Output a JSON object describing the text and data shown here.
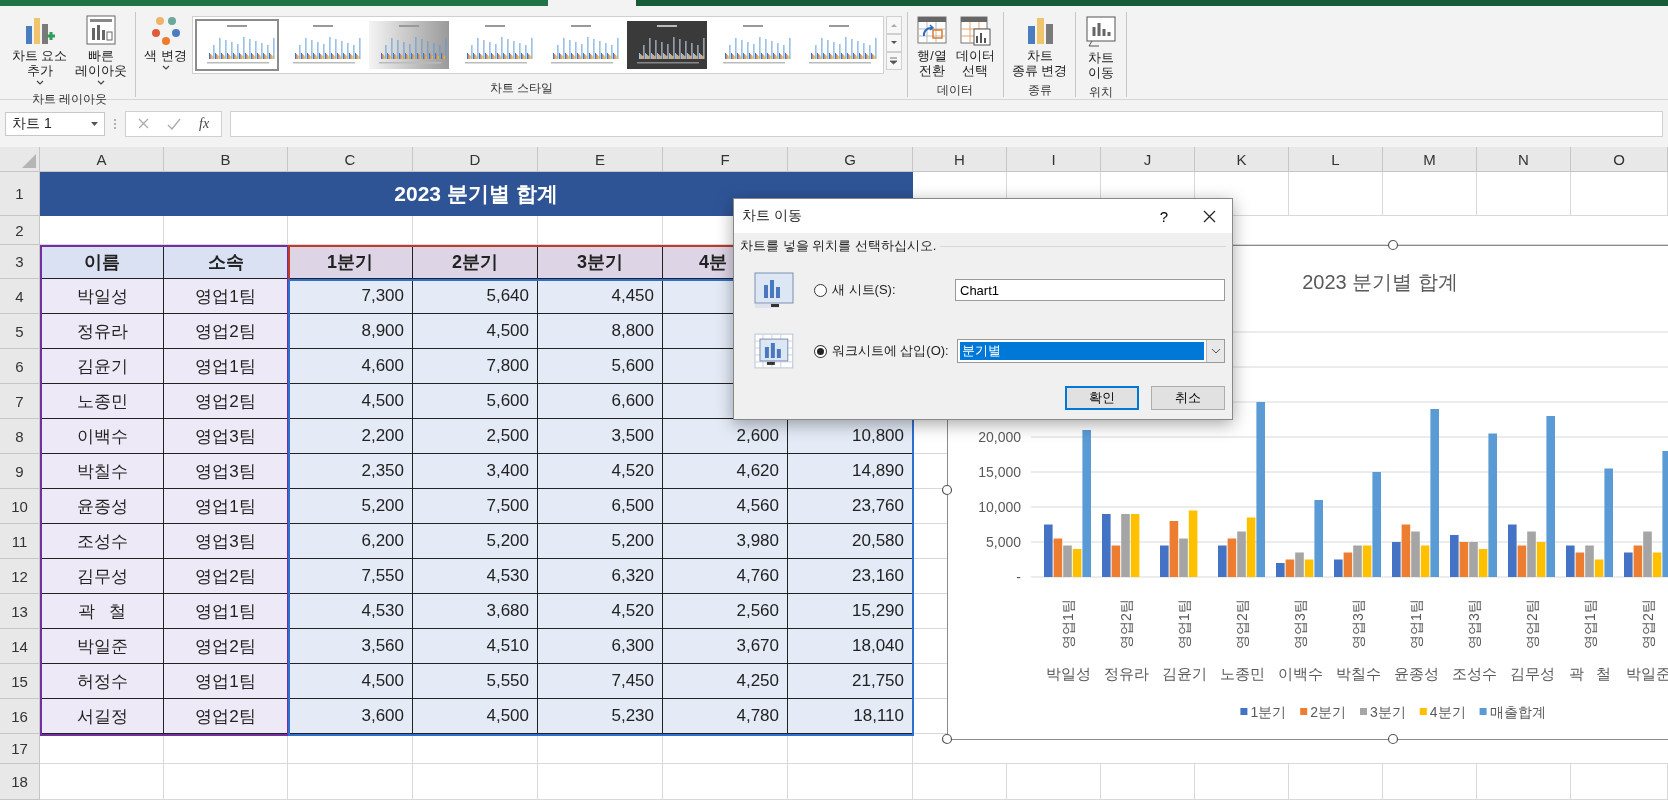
{
  "ribbon": {
    "groups": [
      {
        "label": "차트 레이아웃",
        "buttons": [
          {
            "kind": "chart-elements",
            "lines": [
              "차트 요소",
              "추가"
            ],
            "dropdown": true
          },
          {
            "kind": "quick-layout",
            "lines": [
              "빠른",
              "레이아웃"
            ],
            "dropdown": true
          }
        ]
      },
      {
        "label": "차트 스타일",
        "buttons": [
          {
            "kind": "colors",
            "lines": [
              "색 변경"
            ],
            "dropdown": true
          }
        ],
        "gallery": [
          {
            "kind": "white",
            "selected": true
          },
          {
            "kind": "white",
            "selected": false
          },
          {
            "kind": "gray",
            "selected": false
          },
          {
            "kind": "white",
            "selected": false
          },
          {
            "kind": "white",
            "selected": false
          },
          {
            "kind": "dark",
            "selected": false
          },
          {
            "kind": "white",
            "selected": false
          },
          {
            "kind": "white",
            "selected": false
          }
        ]
      },
      {
        "label": "데이터",
        "buttons": [
          {
            "kind": "switch",
            "lines": [
              "행/열",
              "전환"
            ]
          },
          {
            "kind": "select-data",
            "lines": [
              "데이터",
              "선택"
            ]
          }
        ]
      },
      {
        "label": "종류",
        "buttons": [
          {
            "kind": "chart-type",
            "lines": [
              "차트",
              "종류 변경"
            ]
          }
        ]
      },
      {
        "label": "위치",
        "buttons": [
          {
            "kind": "move-chart",
            "lines": [
              "차트",
              "이동"
            ]
          }
        ]
      }
    ]
  },
  "formula_bar": {
    "name_box": "차트 1",
    "function_label": "fx"
  },
  "sheet": {
    "columns": [
      "A",
      "B",
      "C",
      "D",
      "E",
      "F",
      "G",
      "H",
      "I",
      "J",
      "K",
      "L",
      "M",
      "N",
      "O"
    ],
    "row_numbers": [
      "1",
      "2",
      "3",
      "4",
      "5",
      "6",
      "7",
      "8",
      "9",
      "10",
      "11",
      "12",
      "13",
      "14",
      "15",
      "16",
      "17",
      "18"
    ],
    "title": "2023 분기별 합계",
    "header": [
      {
        "text": "이름"
      },
      {
        "text": "소속"
      },
      {
        "text": "1분기"
      },
      {
        "text": "2분기"
      },
      {
        "text": "3분기"
      },
      {
        "text": "4분",
        "cut": true
      }
    ],
    "rows": [
      [
        "박일성",
        "영업1팀",
        "7,300",
        "5,640",
        "4,450"
      ],
      [
        "정유라",
        "영업2팀",
        "8,900",
        "4,500",
        "8,800"
      ],
      [
        "김윤기",
        "영업1팀",
        "4,600",
        "7,800",
        "5,600"
      ],
      [
        "노종민",
        "영업2팀",
        "4,500",
        "5,600",
        "6,600"
      ],
      [
        "이백수",
        "영업3팀",
        "2,200",
        "2,500",
        "3,500",
        "2,600",
        "10,800"
      ],
      [
        "박칠수",
        "영업3팀",
        "2,350",
        "3,400",
        "4,520",
        "4,620",
        "14,890"
      ],
      [
        "윤종성",
        "영업1팀",
        "5,200",
        "7,500",
        "6,500",
        "4,560",
        "23,760"
      ],
      [
        "조성수",
        "영업3팀",
        "6,200",
        "5,200",
        "5,200",
        "3,980",
        "20,580"
      ],
      [
        "김무성",
        "영업2팀",
        "7,550",
        "4,530",
        "6,320",
        "4,760",
        "23,160"
      ],
      [
        "곽   철",
        "영업1팀",
        "4,530",
        "3,680",
        "4,520",
        "2,560",
        "15,290"
      ],
      [
        "박일준",
        "영업2팀",
        "3,560",
        "4,510",
        "6,300",
        "3,670",
        "18,040"
      ],
      [
        "허정수",
        "영업1팀",
        "4,500",
        "5,550",
        "7,450",
        "4,250",
        "21,750"
      ],
      [
        "서길정",
        "영업2팀",
        "3,600",
        "4,500",
        "5,230",
        "4,780",
        "18,110"
      ]
    ]
  },
  "chart": {
    "team_labels": [
      "영업1팀",
      "영업2팀",
      "영업1팀",
      "영업2팀",
      "영업3팀",
      "영업3팀",
      "영업1팀",
      "영업3팀",
      "영업2팀",
      "영업1팀",
      "영업2팀"
    ],
    "chart_data": {
      "type": "bar",
      "title": "2023 분기별 합계",
      "categories": [
        "박일성",
        "정유라",
        "김윤기",
        "노종민",
        "이백수",
        "박칠수",
        "윤종성",
        "조성수",
        "김무성",
        "곽   철",
        "박일준"
      ],
      "series": [
        {
          "name": "1분기",
          "color": "#4472c4",
          "values": [
            7500,
            9000,
            4500,
            4500,
            2000,
            2500,
            5000,
            6000,
            7500,
            4500,
            3500
          ]
        },
        {
          "name": "2분기",
          "color": "#ed7d31",
          "values": [
            5500,
            4500,
            8000,
            5500,
            2500,
            3500,
            7500,
            5000,
            4500,
            3500,
            4500
          ]
        },
        {
          "name": "3분기",
          "color": "#a5a5a5",
          "values": [
            4500,
            9000,
            5500,
            6500,
            3500,
            4500,
            6500,
            5000,
            6500,
            4500,
            6500
          ]
        },
        {
          "name": "4분기",
          "color": "#ffc000",
          "values": [
            4000,
            9000,
            9500,
            8500,
            2500,
            4500,
            4500,
            4000,
            5000,
            2500,
            3500
          ]
        },
        {
          "name": "매출합계",
          "color": "#5b9bd5",
          "values": [
            21000,
            null,
            null,
            25000,
            11000,
            15000,
            24000,
            20500,
            23000,
            15500,
            18000
          ]
        }
      ],
      "ylim": [
        0,
        35000
      ],
      "yticks": [
        {
          "value": 0,
          "label": "-"
        },
        {
          "value": 5000,
          "label": "5,000"
        },
        {
          "value": 10000,
          "label": "10,000"
        },
        {
          "value": 15000,
          "label": "15,000"
        },
        {
          "value": 20000,
          "label": "20,000"
        }
      ],
      "orientation": "vertical",
      "stacked": false,
      "grid": true,
      "legend": "bottom"
    }
  },
  "dialog": {
    "title": "차트 이동",
    "help": "?",
    "prompt": "차트를 넣을 위치를 선택하십시오.",
    "options": [
      {
        "kind": "new-sheet",
        "label": "새 시트(S):",
        "selected": false,
        "value": "Chart1"
      },
      {
        "kind": "object-in",
        "label": "워크시트에 삽입(O):",
        "selected": true,
        "value": "분기별"
      }
    ],
    "buttons": [
      {
        "label": "확인",
        "default": true
      },
      {
        "label": "취소",
        "default": false
      }
    ]
  }
}
